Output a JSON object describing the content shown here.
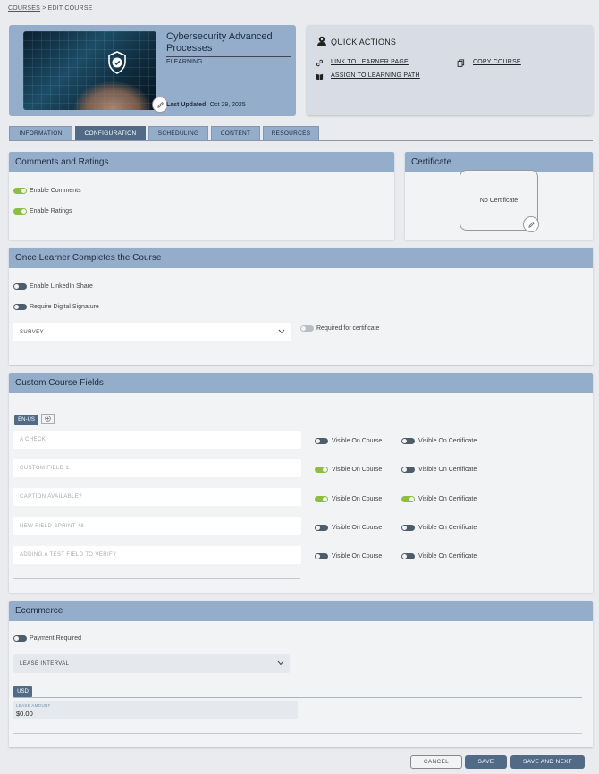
{
  "breadcrumb": {
    "courses": "COURSES",
    "sep": ">",
    "current": "EDIT COURSE"
  },
  "course": {
    "title": "Cybersecurity Advanced Processes",
    "type": "ELEARNING",
    "last_updated_label": "Last Updated:",
    "last_updated_value": "Oct 29, 2025"
  },
  "quick_actions": {
    "title": "QUICK ACTIONS",
    "link_learner": "LINK TO LEARNER PAGE",
    "copy_course": "COPY COURSE",
    "assign_path": "ASSIGN TO LEARNING PATH"
  },
  "tabs": [
    {
      "label": "INFORMATION",
      "active": false
    },
    {
      "label": "CONFIGURATION",
      "active": true
    },
    {
      "label": "SCHEDULING",
      "active": false
    },
    {
      "label": "CONTENT",
      "active": false
    },
    {
      "label": "RESOURCES",
      "active": false
    }
  ],
  "comments": {
    "title": "Comments and Ratings",
    "enable_comments": "Enable Comments",
    "enable_ratings": "Enable Ratings"
  },
  "certificate": {
    "title": "Certificate",
    "empty": "No Certificate"
  },
  "completion": {
    "title": "Once Learner Completes the Course",
    "linkedin": "Enable LinkedIn Share",
    "signature": "Require Digital Signature",
    "survey": "SURVEY",
    "required_cert": "Required for certificate"
  },
  "custom_fields": {
    "title": "Custom Course Fields",
    "lang": "EN-US",
    "visible_course": "Visible On Course",
    "visible_cert": "Visible On Certificate",
    "rows": [
      {
        "placeholder": "A CHECK",
        "course": false,
        "cert": false
      },
      {
        "placeholder": "CUSTOM FIELD 1",
        "course": true,
        "cert": false
      },
      {
        "placeholder": "CAPTION AVAILABLE?",
        "course": true,
        "cert": true
      },
      {
        "placeholder": "NEW FIELD SPRINT 48",
        "course": false,
        "cert": false
      },
      {
        "placeholder": "ADDING A TEST FIELD TO VERIFY",
        "course": false,
        "cert": false
      }
    ]
  },
  "ecommerce": {
    "title": "Ecommerce",
    "payment_required": "Payment Required",
    "lease_interval": "LEASE INTERVAL",
    "currency": "USD",
    "lease_amount_label": "LEASE AMOUNT",
    "lease_amount_value": "$0.00"
  },
  "buttons": {
    "cancel": "CANCEL",
    "save": "SAVE",
    "save_next": "SAVE AND NEXT"
  }
}
